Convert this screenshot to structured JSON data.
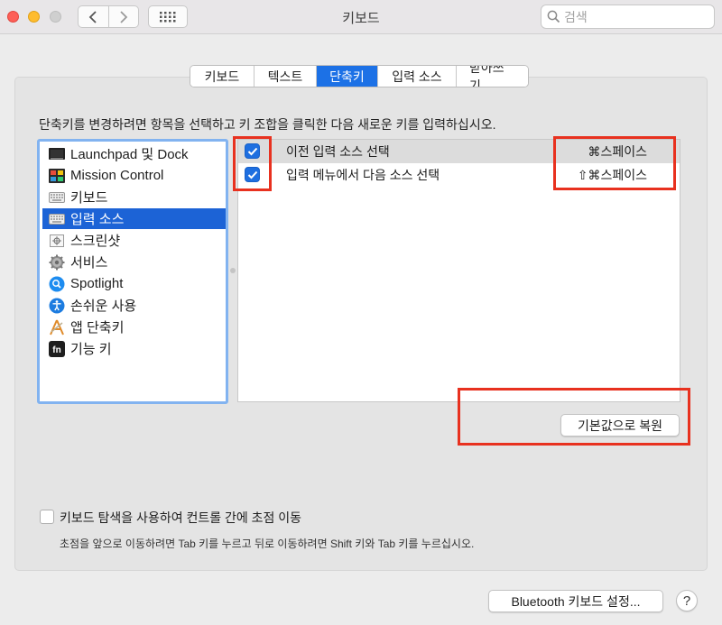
{
  "window": {
    "title": "키보드"
  },
  "search": {
    "placeholder": "검색"
  },
  "tabs": [
    {
      "label": "키보드",
      "active": false
    },
    {
      "label": "텍스트",
      "active": false
    },
    {
      "label": "단축키",
      "active": true
    },
    {
      "label": "입력 소스",
      "active": false
    },
    {
      "label": "받아쓰기",
      "active": false
    }
  ],
  "instructions": "단축키를 변경하려면 항목을 선택하고 키 조합을 클릭한 다음 새로운 키를 입력하십시오.",
  "categories": [
    {
      "label": "Launchpad 및 Dock",
      "icon": "launchpad-icon"
    },
    {
      "label": "Mission Control",
      "icon": "mission-control-icon"
    },
    {
      "label": "키보드",
      "icon": "keyboard-icon"
    },
    {
      "label": "입력 소스",
      "icon": "keyboard-icon",
      "selected": true
    },
    {
      "label": "스크린샷",
      "icon": "screenshot-icon"
    },
    {
      "label": "서비스",
      "icon": "gear-icon"
    },
    {
      "label": "Spotlight",
      "icon": "spotlight-icon"
    },
    {
      "label": "손쉬운 사용",
      "icon": "accessibility-icon"
    },
    {
      "label": "앱 단축키",
      "icon": "app-shortcuts-icon"
    },
    {
      "label": "기능 키",
      "icon": "fn-key-icon"
    }
  ],
  "shortcuts": [
    {
      "checked": true,
      "label": "이전 입력 소스 선택",
      "keys": "⌘스페이스"
    },
    {
      "checked": true,
      "label": "입력 메뉴에서 다음 소스 선택",
      "keys": "⇧⌘스페이스"
    }
  ],
  "restore_defaults_label": "기본값으로 복원",
  "keyboard_navigation": {
    "checked": false,
    "label": "키보드 탐색을 사용하여 컨트롤 간에 초점 이동",
    "hint": "초점을 앞으로 이동하려면 Tab 키를 누르고 뒤로 이동하려면 Shift 키와 Tab 키를 누르십시오."
  },
  "bluetooth_button_label": "Bluetooth 키보드 설정...",
  "help_label": "?",
  "colors": {
    "accent": "#1c71e6",
    "selection": "#1c63d6",
    "highlight_box": "#e8311f"
  }
}
